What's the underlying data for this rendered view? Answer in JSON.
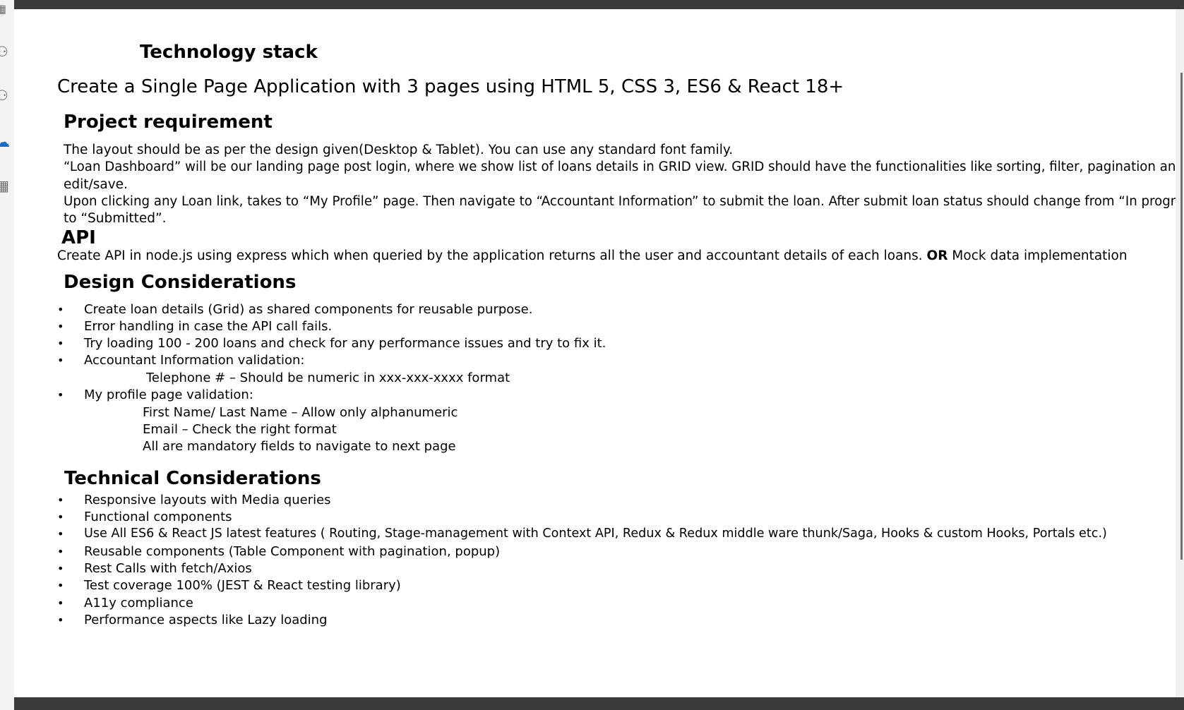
{
  "rail": {
    "icons": [
      "calendar-icon",
      "people-icon",
      "teams-icon",
      "onedrive-icon",
      "apps-icon"
    ]
  },
  "doc": {
    "tech_stack_heading": "Technology stack",
    "subtitle": "Create a Single Page Application with 3 pages using HTML 5, CSS 3, ES6 & React 18+",
    "project_heading": "Project requirement",
    "project_lines": [
      "The layout should be as per the design given(Desktop & Tablet). You can use any standard font family.",
      "“Loan Dashboard” will be our landing page post login, where we show list of loans details in GRID view. GRID should have the functionalities like sorting, filter, pagination and row",
      "edit/save.",
      "Upon clicking any Loan link, takes to “My Profile” page.  Then navigate to “Accountant Information” to submit the loan. After submit loan status should change from “In progress”",
      "to “Submitted”."
    ],
    "api_heading": "API",
    "api_text_1": "Create API in node.js using express which when queried by the  application returns all the user and accountant details of each loans. ",
    "api_or": "OR",
    "api_text_2": " Mock data implementation",
    "design_heading": "Design Considerations",
    "design_items": [
      "Create loan details (Grid) as shared components for reusable purpose.",
      "Error handling in case the API call fails.",
      "Try loading 100 - 200 loans and check for any performance issues and try to fix it.",
      "Accountant Information validation:",
      "My profile page validation:"
    ],
    "accountant_sub": "Telephone # – Should be numeric in xxx-xxx-xxxx format",
    "profile_subs": [
      "First Name/ Last Name – Allow only alphanumeric",
      "Email – Check the right format",
      "All are mandatory fields to navigate to next page"
    ],
    "tech_heading": "Technical Considerations",
    "tech_items": [
      "Responsive layouts with Media queries",
      "Functional components",
      "Use All ES6 & React JS latest features ( Routing, Stage-management with Context API, Redux & Redux middle ware thunk/Saga, Hooks & custom Hooks, Portals etc.)",
      "Reusable components (Table Component with pagination, popup)",
      "Rest Calls with fetch/Axios",
      "Test coverage 100% (JEST & React testing library)",
      "A11y compliance",
      "Performance aspects like Lazy loading"
    ],
    "bullet": "•"
  }
}
